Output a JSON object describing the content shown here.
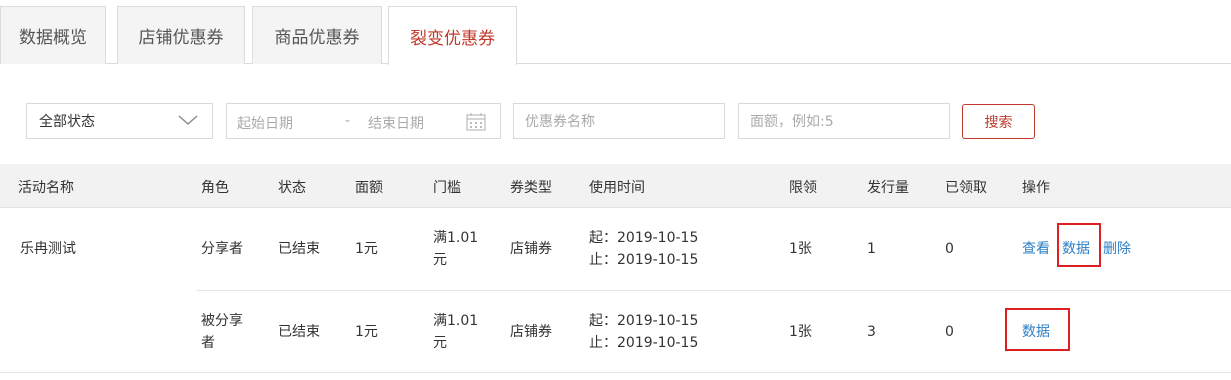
{
  "tabs": [
    {
      "label": "数据概览",
      "active": false
    },
    {
      "label": "店铺优惠券",
      "active": false
    },
    {
      "label": "商品优惠券",
      "active": false
    },
    {
      "label": "裂变优惠券",
      "active": true
    }
  ],
  "filters": {
    "status_select": {
      "value": "全部状态"
    },
    "date_range": {
      "start_placeholder": "起始日期",
      "separator": "-",
      "end_placeholder": "结束日期"
    },
    "coupon_name": {
      "placeholder": "优惠券名称"
    },
    "amount": {
      "placeholder": "面额，例如:5"
    },
    "search_label": "搜索"
  },
  "table": {
    "headers": [
      "活动名称",
      "角色",
      "状态",
      "面额",
      "门槛",
      "券类型",
      "使用时间",
      "限领",
      "发行量",
      "已领取",
      "操作"
    ],
    "activity_name": "乐冉测试",
    "rows": [
      {
        "role": "分享者",
        "status": "已结束",
        "amount": "1元",
        "threshold_line1": "满1.01",
        "threshold_line2": "元",
        "coupon_type": "店铺券",
        "time_start": "起：2019-10-15",
        "time_end": "止：2019-10-15",
        "limit": "1张",
        "issued": "1",
        "claimed": "0",
        "actions": {
          "view": "查看",
          "data": "数据",
          "delete": "删除"
        }
      },
      {
        "role_line1": "被分享",
        "role_line2": "者",
        "status": "已结束",
        "amount": "1元",
        "threshold_line1": "满1.01",
        "threshold_line2": "元",
        "coupon_type": "店铺券",
        "time_start": "起：2019-10-15",
        "time_end": "止：2019-10-15",
        "limit": "1张",
        "issued": "3",
        "claimed": "0",
        "actions": {
          "data": "数据"
        }
      }
    ]
  },
  "colors": {
    "accent": "#c0392b",
    "link": "#2d7fc6",
    "highlight": "#e02020"
  }
}
